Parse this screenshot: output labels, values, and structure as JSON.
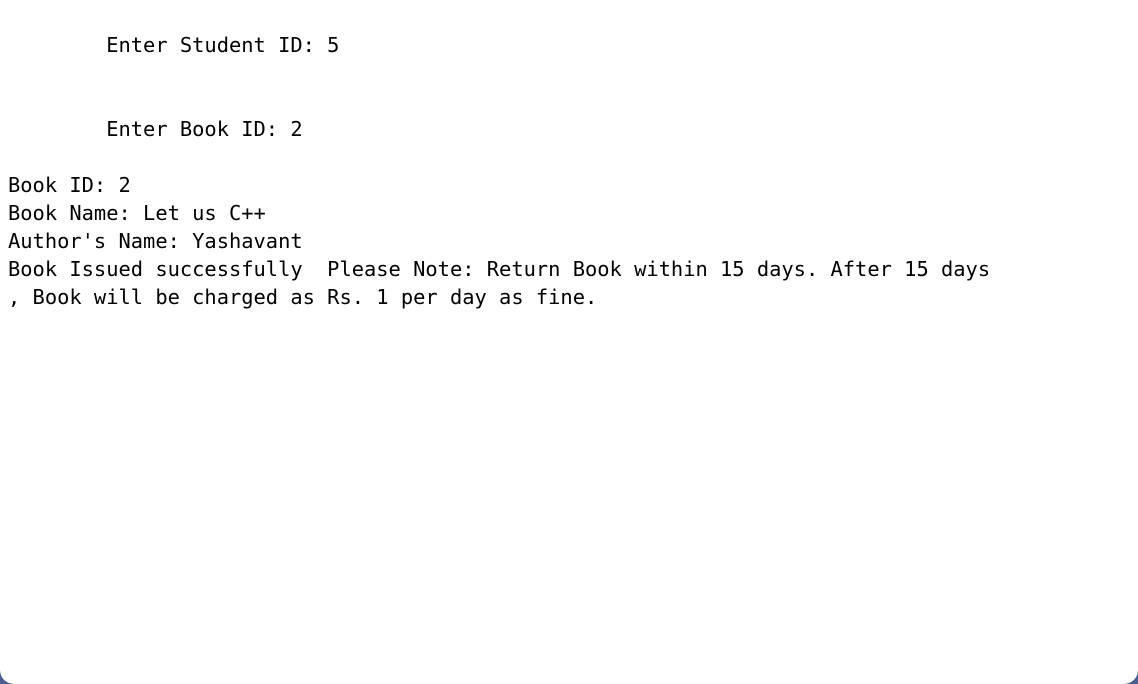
{
  "console": {
    "lines": [
      "        Enter Student ID: 5",
      "        Enter Book ID: 2",
      "Book ID: 2",
      "Book Name: Let us C++",
      "Author's Name: Yashavant",
      "Book Issued successfully  Please Note: Return Book within 15 days. After 15 days",
      ", Book will be charged as Rs. 1 per day as fine."
    ]
  }
}
